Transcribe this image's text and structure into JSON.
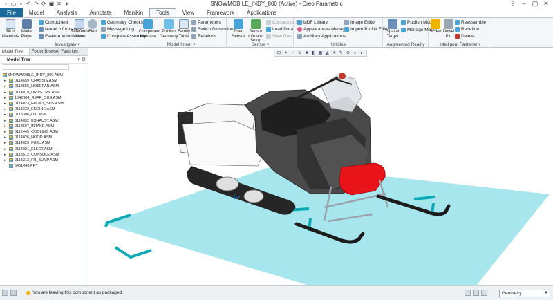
{
  "window": {
    "title": "SNOWMOBILE_INDY_800 (Active) - Creo Parametric"
  },
  "tabs": [
    {
      "label": "File"
    },
    {
      "label": "Model"
    },
    {
      "label": "Analysis"
    },
    {
      "label": "Annotate"
    },
    {
      "label": "Manikin"
    },
    {
      "label": "Tools"
    },
    {
      "label": "View"
    },
    {
      "label": "Framework"
    },
    {
      "label": "Applications"
    }
  ],
  "ribbon": {
    "investigate": {
      "label": "Investigate ▾",
      "bill_of_materials": "Bill of Materials",
      "model_player": "Model Player",
      "component": "Component",
      "model_information": "Model Information",
      "feature_information": "Feature Information",
      "reference_viewer": "Reference Viewer",
      "find": "Find",
      "geometry_checks": "Geometry Checks",
      "message_log": "Message Log",
      "compare_assembly": "Compare Assembly"
    },
    "model_intent": {
      "label": "Model Intent ▾",
      "component_interface": "Component Interface",
      "publish_geometry": "Publish Geometry",
      "family_table": "Family Table",
      "parameters": "Parameters",
      "switch_dimensions": "Switch Dimensions",
      "relations": "Relations"
    },
    "sensor": {
      "label": "Sensor ▾",
      "insert_sensor": "Insert Sensor",
      "sensor_info": "Sensor Info and Setup",
      "connect_to_server": "Connect to Server",
      "load_data": "Load Data",
      "view_data": "View Data"
    },
    "utilities": {
      "label": "Utilities",
      "udf_library": "UDF Library",
      "appearances_manager": "Appearances Manager",
      "auxiliary_applications": "Auxiliary Applications",
      "image_editor": "Image Editor",
      "import_profile_editor": "Import Profile Editor"
    },
    "augmented_reality": {
      "label": "Augmented Reality",
      "spatial_target": "Spatial Target",
      "publish_model": "Publish Model",
      "manage_model": "Manage Model"
    },
    "intelligent_fastener": {
      "label": "Intelligent Fastener ▾",
      "screw": "Screw",
      "dowel_pin": "Dowel Pin",
      "reassemble": "Reassemble",
      "redefine": "Redefine",
      "delete": "Delete"
    }
  },
  "navigator": {
    "tabs": [
      "Model Tree",
      "Folder Browser",
      "Favorites"
    ],
    "header": "Model Tree",
    "items": [
      {
        "label": "SNOWMOBILE_INDY_800.ASM",
        "kind": "root"
      },
      {
        "label": "0114659_CHASSIS.ASM",
        "kind": "asm"
      },
      {
        "label": "0113555_NOSEPAN.ASM",
        "kind": "asm"
      },
      {
        "label": "0114019_DRIVETRN.ASM",
        "kind": "asm"
      },
      {
        "label": "1542904_REAR_SUS.ASM",
        "kind": "asm"
      },
      {
        "label": "0114023_FRONT_SUS.ASM",
        "kind": "asm"
      },
      {
        "label": "0113332_ENGINE.ASM",
        "kind": "asm"
      },
      {
        "label": "0113306_OIL.ASM",
        "kind": "asm"
      },
      {
        "label": "0114052_EXHAUST.ASM",
        "kind": "asm"
      },
      {
        "label": "0113507_INTAKE.ASM",
        "kind": "asm"
      },
      {
        "label": "0112445_COOLING.ASM",
        "kind": "asm"
      },
      {
        "label": "0114026_HOOD.ASM",
        "kind": "asm"
      },
      {
        "label": "0114025_FUEL.ASM",
        "kind": "asm"
      },
      {
        "label": "0114021_ELECT.ASM",
        "kind": "asm"
      },
      {
        "label": "0113512_CONSOLE.ASM",
        "kind": "asm"
      },
      {
        "label": "0113313_FR_BUMP.ASM",
        "kind": "asm"
      },
      {
        "label": "5451043.PRT",
        "kind": "part"
      }
    ]
  },
  "status": {
    "message": "You are leaving this component as packaged.",
    "filter": "Geometry"
  },
  "colors": {
    "file_tab": "#1a6b9a",
    "ground_plane": "#a8e6ee",
    "ground_frame": "#0ba9b5",
    "hood_red": "#e8141a"
  }
}
